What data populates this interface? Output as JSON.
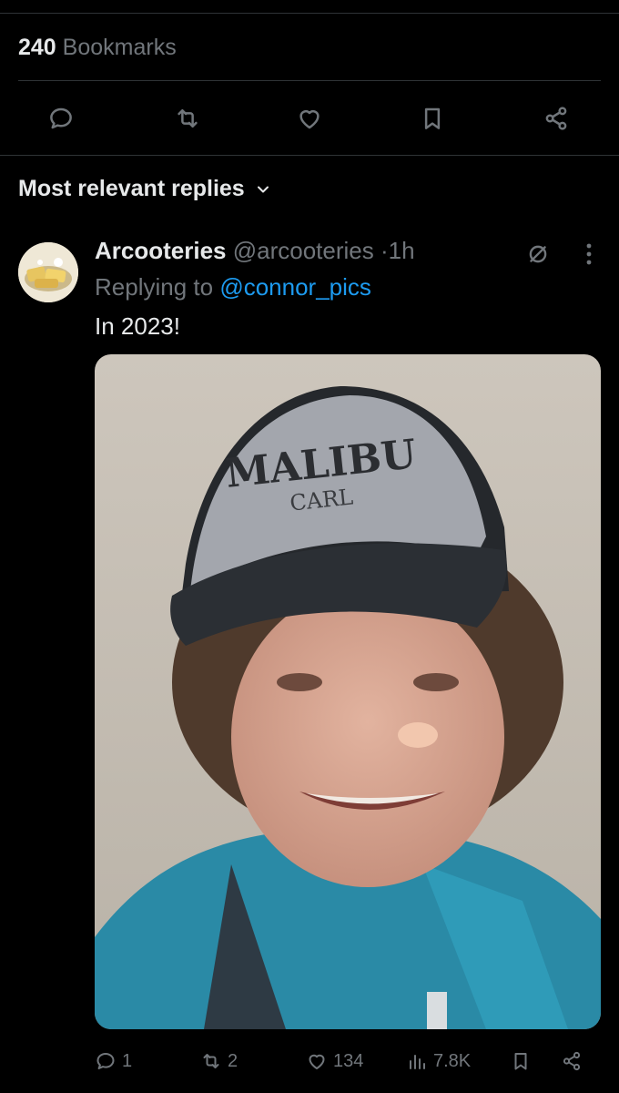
{
  "tweet_stats": {
    "bookmarks_count": "240",
    "bookmarks_label": "Bookmarks"
  },
  "tweet_actions": [
    "reply-icon",
    "retweet-icon",
    "like-icon",
    "bookmark-icon",
    "share-icon"
  ],
  "replies": {
    "sort_label": "Most relevant replies",
    "items": [
      {
        "name": "Arcooteries",
        "handle": "@arcooteries",
        "separator": "·",
        "time": "1h",
        "replying_prefix": "Replying to",
        "replying_to": "@connor_pics",
        "text": "In 2023!",
        "media_cap_text": "MALIBU\nCARL",
        "stats": {
          "replies": "1",
          "reposts": "2",
          "likes": "134",
          "views": "7.8K"
        }
      }
    ]
  },
  "colors": {
    "background": "#000000",
    "text_primary": "#e7e9ea",
    "text_secondary": "#71767b",
    "accent_link": "#1d9bf0",
    "divider": "#2f3336"
  }
}
